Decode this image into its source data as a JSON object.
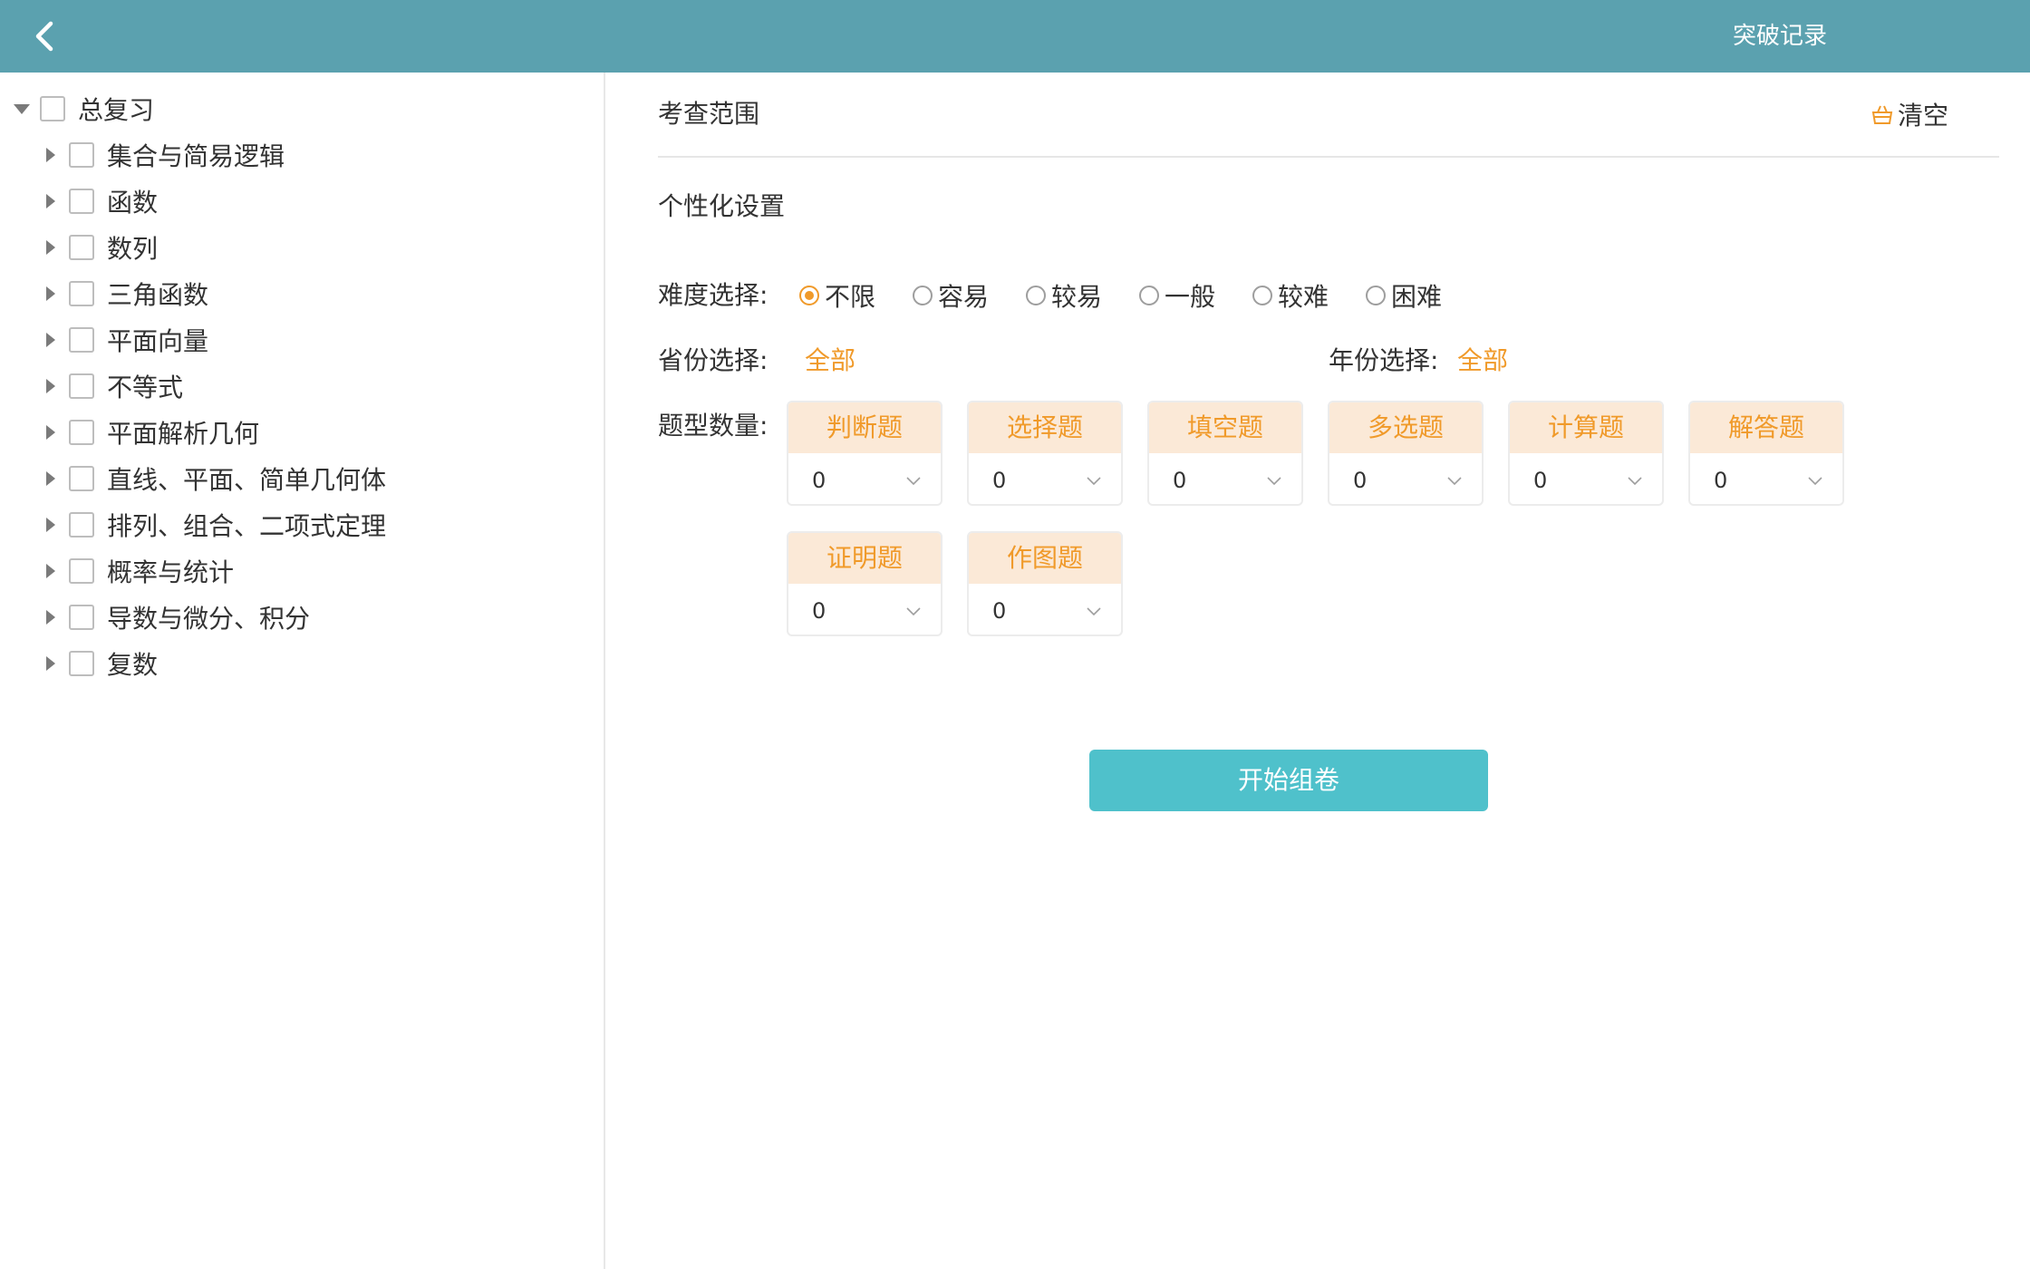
{
  "header": {
    "back_icon": "chevron-left-icon",
    "records_label": "突破记录",
    "bg_color": "#5ba1af"
  },
  "tree": {
    "root": {
      "label": "总复习",
      "expanded": true,
      "checked": false
    },
    "children": [
      {
        "label": "集合与简易逻辑",
        "checked": false
      },
      {
        "label": "函数",
        "checked": false
      },
      {
        "label": "数列",
        "checked": false
      },
      {
        "label": "三角函数",
        "checked": false
      },
      {
        "label": "平面向量",
        "checked": false
      },
      {
        "label": "不等式",
        "checked": false
      },
      {
        "label": "平面解析几何",
        "checked": false
      },
      {
        "label": "直线、平面、简单几何体",
        "checked": false
      },
      {
        "label": "排列、组合、二项式定理",
        "checked": false
      },
      {
        "label": "概率与统计",
        "checked": false
      },
      {
        "label": "导数与微分、积分",
        "checked": false
      },
      {
        "label": "复数",
        "checked": false
      }
    ]
  },
  "scope": {
    "title": "考查范围",
    "clear_label": "清空",
    "clear_icon": "basket-icon"
  },
  "settings": {
    "title": "个性化设置",
    "difficulty": {
      "label": "难度选择:",
      "options": [
        "不限",
        "容易",
        "较易",
        "一般",
        "较难",
        "困难"
      ],
      "selected": "不限"
    },
    "province": {
      "label": "省份选择:",
      "value": "全部"
    },
    "year": {
      "label": "年份选择:",
      "value": "全部"
    },
    "question_types": {
      "label": "题型数量:",
      "items": [
        {
          "name": "判断题",
          "count": "0"
        },
        {
          "name": "选择题",
          "count": "0"
        },
        {
          "name": "填空题",
          "count": "0"
        },
        {
          "name": "多选题",
          "count": "0"
        },
        {
          "name": "计算题",
          "count": "0"
        },
        {
          "name": "解答题",
          "count": "0"
        },
        {
          "name": "证明题",
          "count": "0"
        },
        {
          "name": "作图题",
          "count": "0"
        }
      ]
    }
  },
  "start_button": {
    "label": "开始组卷",
    "color": "#4fc1cb"
  },
  "accent_color": "#f09a2a"
}
